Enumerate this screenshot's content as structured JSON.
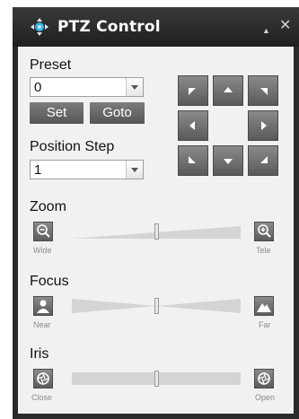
{
  "window": {
    "title": "PTZ Control",
    "collapse_glyph": "▲",
    "close_glyph": "✕"
  },
  "preset": {
    "label": "Preset",
    "value": "0",
    "set_label": "Set",
    "goto_label": "Goto"
  },
  "position_step": {
    "label": "Position Step",
    "value": "1"
  },
  "zoom": {
    "label": "Zoom",
    "min_label": "Wide",
    "max_label": "Tele",
    "level": 0.5
  },
  "focus": {
    "label": "Focus",
    "min_label": "Near",
    "max_label": "Far",
    "level": 0.5
  },
  "iris": {
    "label": "Iris",
    "min_label": "Close",
    "max_label": "Open",
    "level": 0.5
  },
  "icons": {
    "title": "ptz-crosshair-icon",
    "zoom_out": "magnifier-minus-icon",
    "zoom_in": "magnifier-plus-icon",
    "focus_near": "person-icon",
    "focus_far": "mountain-icon",
    "iris_close": "aperture-icon",
    "iris_open": "aperture-icon"
  },
  "colors": {
    "title_bar": "#2a2a2a",
    "panel": "#f1f1f1",
    "button": "#6a6a6a",
    "title_icon": "#35b6e5"
  }
}
